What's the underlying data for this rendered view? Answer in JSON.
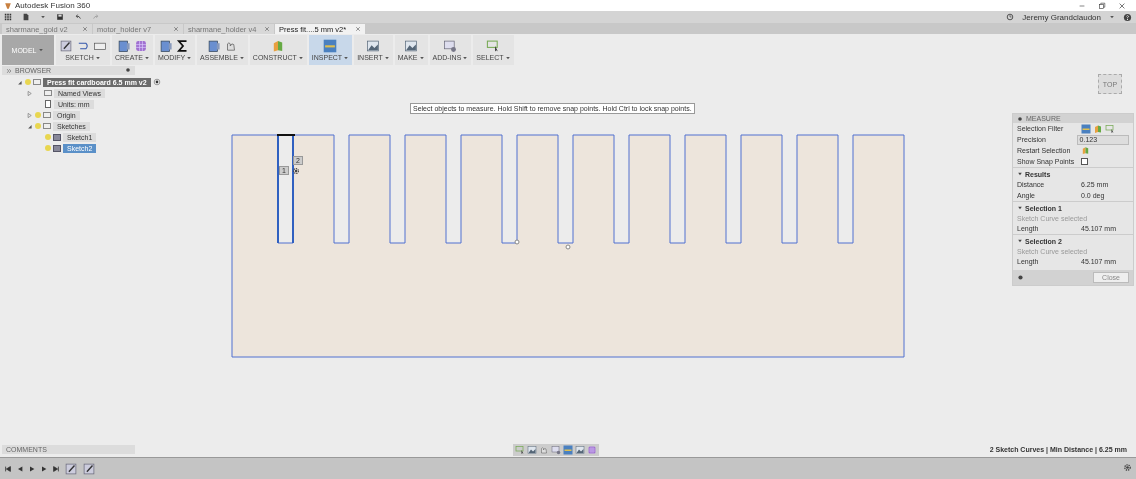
{
  "window": {
    "title": "Autodesk Fusion 360"
  },
  "tabs": [
    {
      "label": "sharmane_gold v2",
      "selected": false
    },
    {
      "label": "motor_holder v7",
      "selected": false
    },
    {
      "label": "sharmane_holder v4",
      "selected": false
    },
    {
      "label": "Press fit....5 mm v2*",
      "selected": true
    }
  ],
  "user": "Jeremy Grandclaudon",
  "ribbon": {
    "workspace": "MODEL",
    "groups": [
      {
        "label": "SKETCH",
        "selected": false
      },
      {
        "label": "CREATE",
        "selected": false
      },
      {
        "label": "MODIFY",
        "selected": false
      },
      {
        "label": "ASSEMBLE",
        "selected": false
      },
      {
        "label": "CONSTRUCT",
        "selected": false
      },
      {
        "label": "INSPECT",
        "selected": true
      },
      {
        "label": "INSERT",
        "selected": false
      },
      {
        "label": "MAKE",
        "selected": false
      },
      {
        "label": "ADD-INS",
        "selected": false
      },
      {
        "label": "SELECT",
        "selected": false
      }
    ]
  },
  "browser": {
    "title": "BROWSER",
    "root": {
      "label": "Press fit cardboard 6.5 mm v2",
      "expanded": true,
      "children": [
        {
          "label": "Named Views",
          "kind": "folder",
          "bulb": false,
          "expanded": false,
          "selected": false
        },
        {
          "label": "Units: mm",
          "kind": "units",
          "bulb": false,
          "selected": false
        },
        {
          "label": "Origin",
          "kind": "folder",
          "bulb": true,
          "expanded": false,
          "selected": false
        },
        {
          "label": "Sketches",
          "kind": "folder",
          "bulb": true,
          "expanded": true,
          "selected": false,
          "children": [
            {
              "label": "Sketch1",
              "kind": "sketch",
              "bulb": true,
              "selected": false
            },
            {
              "label": "Sketch2",
              "kind": "sketch",
              "bulb": true,
              "selected": true
            }
          ]
        }
      ]
    }
  },
  "tooltip": "Select objects to measure. Hold Shift to remove snap points. Hold Ctrl to lock snap points.",
  "snap_labels": [
    "1",
    "2"
  ],
  "viewcube": "TOP",
  "measure": {
    "title": "MEASURE",
    "selection_filter": "Selection Filter",
    "precision_label": "Precision",
    "precision": "0.123",
    "restart": "Restart Selection",
    "snap_points": "Show Snap Points",
    "snap_checked": false,
    "sections": [
      {
        "title": "Results",
        "rows": [
          {
            "label": "Distance",
            "value": "6.25 mm"
          },
          {
            "label": "Angle",
            "value": "0.0 deg"
          }
        ]
      },
      {
        "title": "Selection 1",
        "hint": "Sketch Curve selected",
        "rows": [
          {
            "label": "Length",
            "value": "45.107 mm"
          }
        ]
      },
      {
        "title": "Selection 2",
        "hint": "Sketch Curve selected",
        "rows": [
          {
            "label": "Length",
            "value": "45.107 mm"
          }
        ]
      }
    ],
    "close": "Close"
  },
  "comments": "COMMENTS",
  "status": "2 Sketch Curves | Min Distance | 6.25 mm"
}
